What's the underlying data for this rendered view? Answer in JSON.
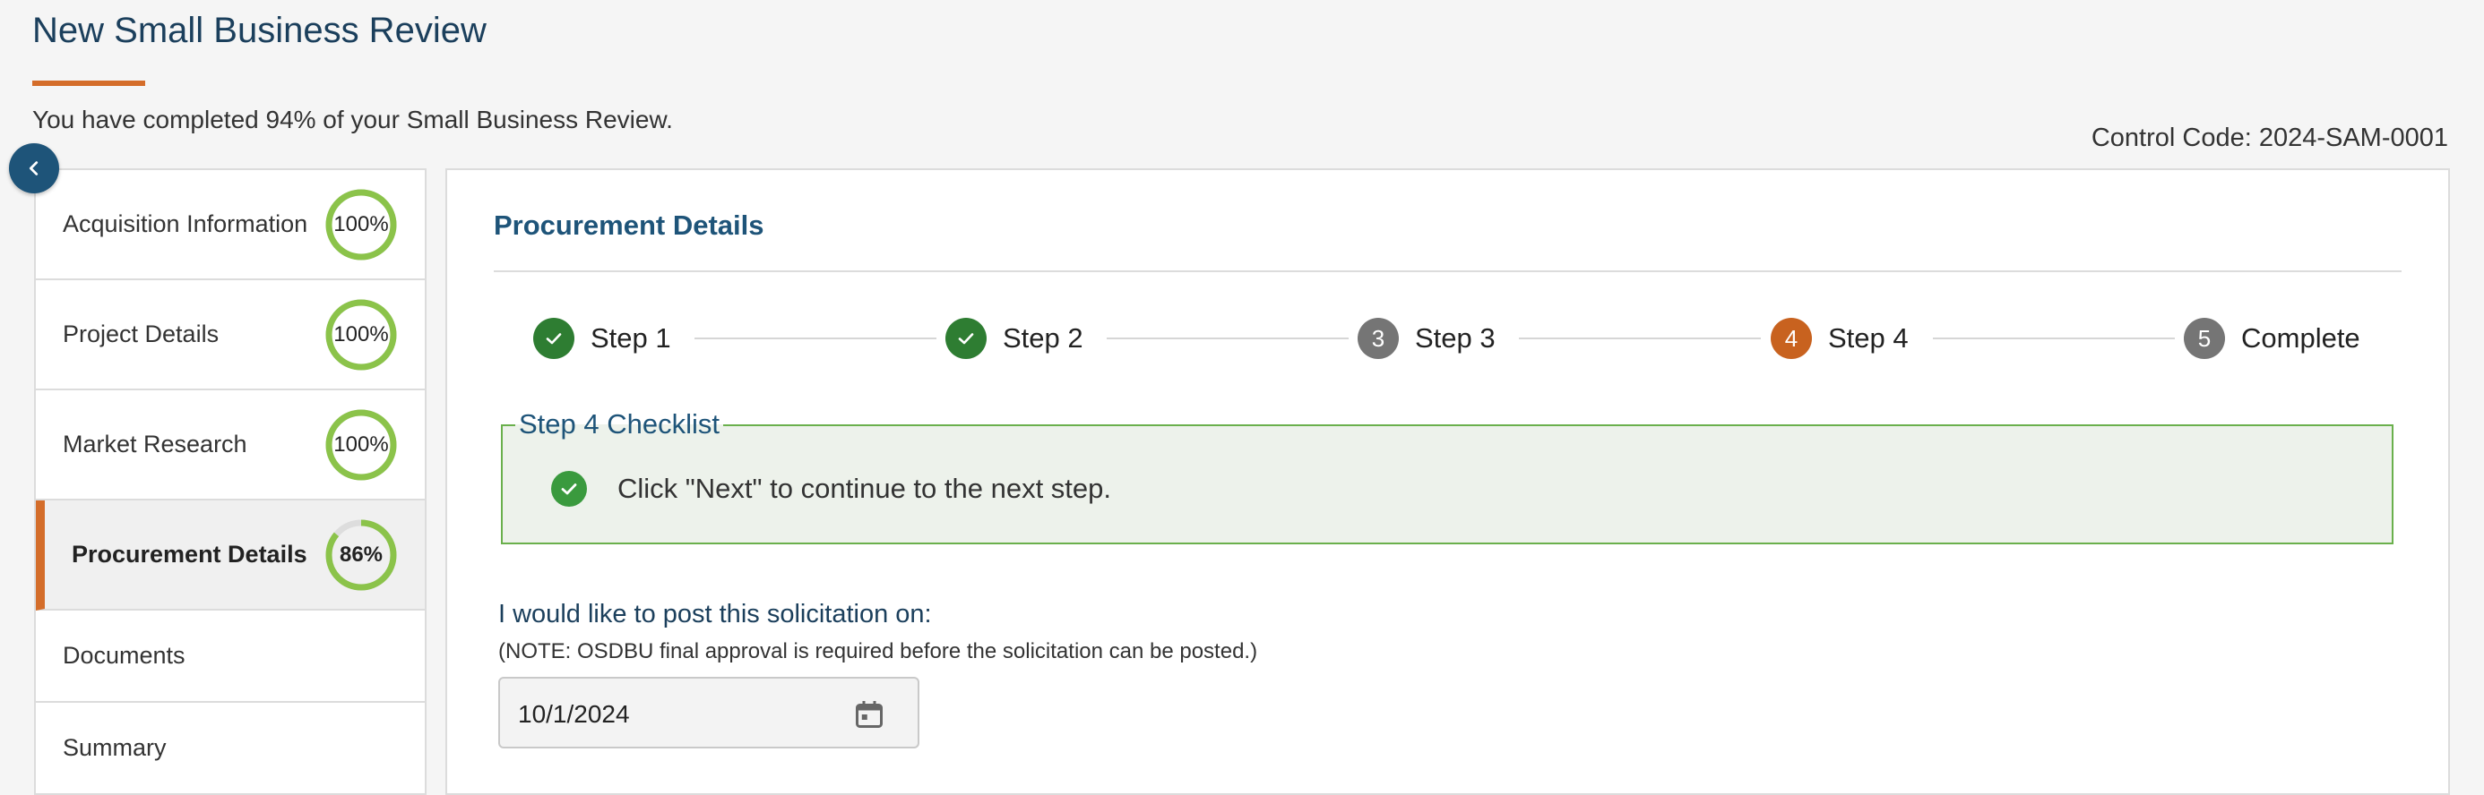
{
  "header": {
    "title": "New Small Business Review",
    "progress_text": "You have completed 94% of your Small Business Review.",
    "control_code": "Control Code: 2024-SAM-0001"
  },
  "sidebar": {
    "items": [
      {
        "label": "Acquisition Information",
        "percent_label": "100%",
        "percent": 100,
        "active": false
      },
      {
        "label": "Project Details",
        "percent_label": "100%",
        "percent": 100,
        "active": false
      },
      {
        "label": "Market Research",
        "percent_label": "100%",
        "percent": 100,
        "active": false
      },
      {
        "label": "Procurement Details",
        "percent_label": "86%",
        "percent": 86,
        "active": true
      },
      {
        "label": "Documents"
      },
      {
        "label": "Summary"
      }
    ]
  },
  "main": {
    "section_title": "Procurement Details",
    "steps": [
      {
        "label": "Step 1",
        "number": "",
        "state": "done"
      },
      {
        "label": "Step 2",
        "number": "",
        "state": "done"
      },
      {
        "label": "Step 3",
        "number": "3",
        "state": "pending"
      },
      {
        "label": "Step 4",
        "number": "4",
        "state": "current"
      },
      {
        "label": "Complete",
        "number": "5",
        "state": "pending"
      }
    ],
    "checklist": {
      "legend": "Step 4 Checklist",
      "item": "Click \"Next\" to continue to the next step."
    },
    "post_label": "I would like to post this solicitation on:",
    "post_note": "(NOTE: OSDBU final approval is required before the solicitation can be posted.)",
    "date_value": "10/1/2024"
  },
  "colors": {
    "accent_orange": "#d46d2a",
    "primary_blue": "#1e5479",
    "success_green": "#2e7d32",
    "ring_green": "#8bc34a",
    "ring_track": "#dddddd"
  },
  "icons": {
    "collapse": "chevron-left-icon",
    "check": "check-icon",
    "calendar": "calendar-icon"
  }
}
